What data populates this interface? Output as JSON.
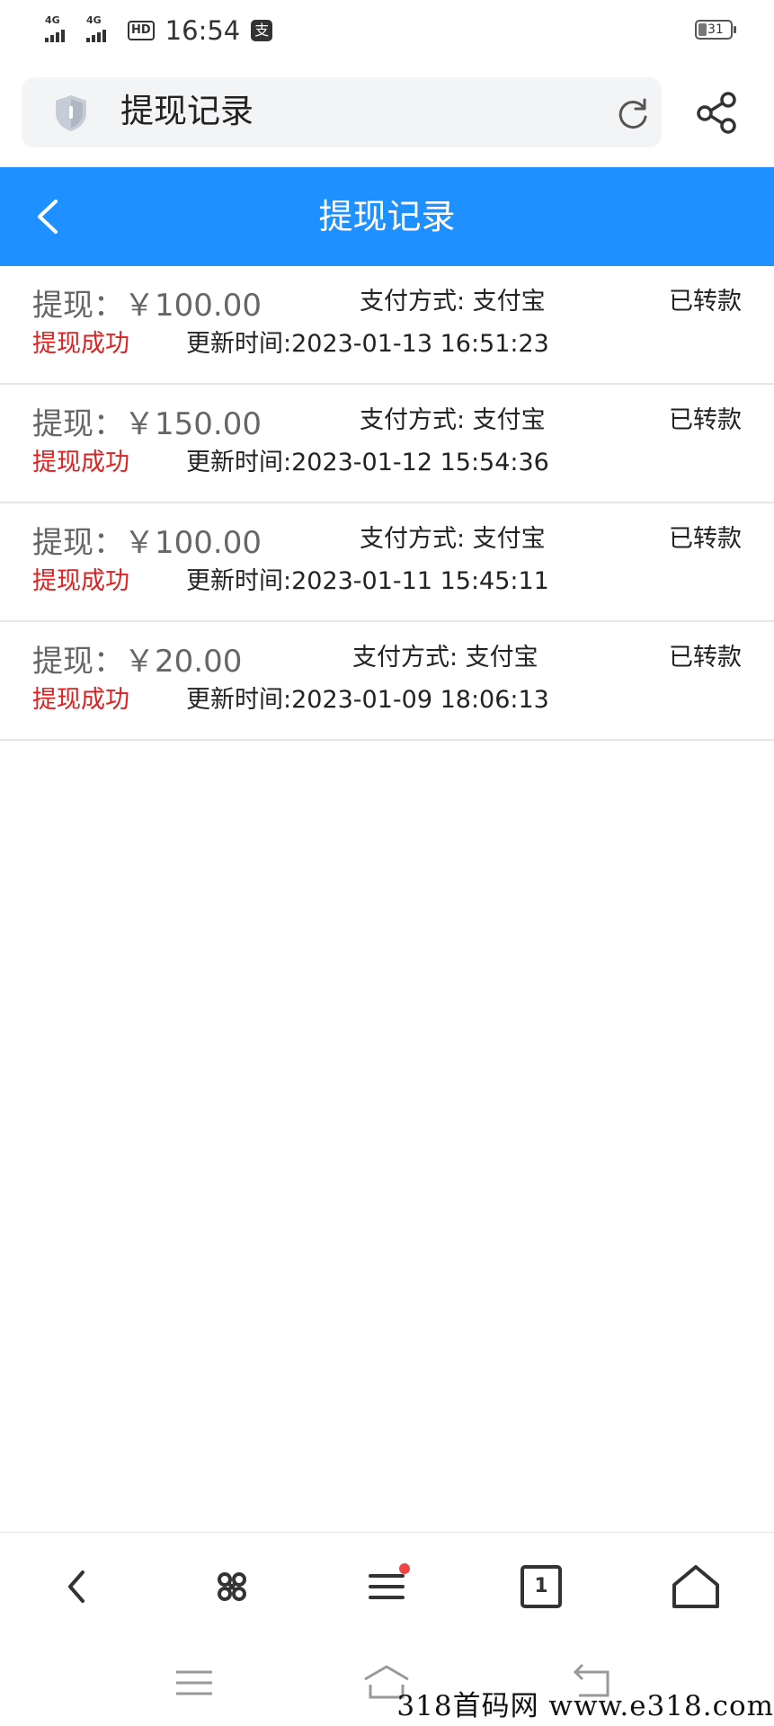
{
  "status_bar": {
    "signal1": "4G",
    "signal2": "4G",
    "hd": "HD",
    "time": "16:54",
    "pay_icon": "支",
    "battery": "31"
  },
  "browser": {
    "address_text": "提现记录",
    "icons": {
      "shield": "shield-icon",
      "refresh": "refresh-icon",
      "share": "share-icon"
    }
  },
  "page": {
    "title": "提现记录",
    "header_color": "#1e90ff"
  },
  "records": [
    {
      "amount": "提现：￥100.00",
      "payment": "支付方式: 支付宝",
      "status": "已转款",
      "result": "提现成功",
      "updated": "更新时间:2023-01-13 16:51:23"
    },
    {
      "amount": "提现：￥150.00",
      "payment": "支付方式: 支付宝",
      "status": "已转款",
      "result": "提现成功",
      "updated": "更新时间:2023-01-12 15:54:36"
    },
    {
      "amount": "提现：￥100.00",
      "payment": "支付方式: 支付宝",
      "status": "已转款",
      "result": "提现成功",
      "updated": "更新时间:2023-01-11 15:45:11"
    },
    {
      "amount": "提现：￥20.00",
      "payment": "支付方式: 支付宝",
      "status": "已转款",
      "result": "提现成功",
      "updated": "更新时间:2023-01-09 18:06:13"
    }
  ],
  "toolbar": {
    "tab_count": "1",
    "items": [
      "back-icon",
      "command-icon",
      "menu-icon",
      "tabs-icon",
      "home-icon"
    ]
  },
  "watermark": "318首码网  www.e318.com"
}
